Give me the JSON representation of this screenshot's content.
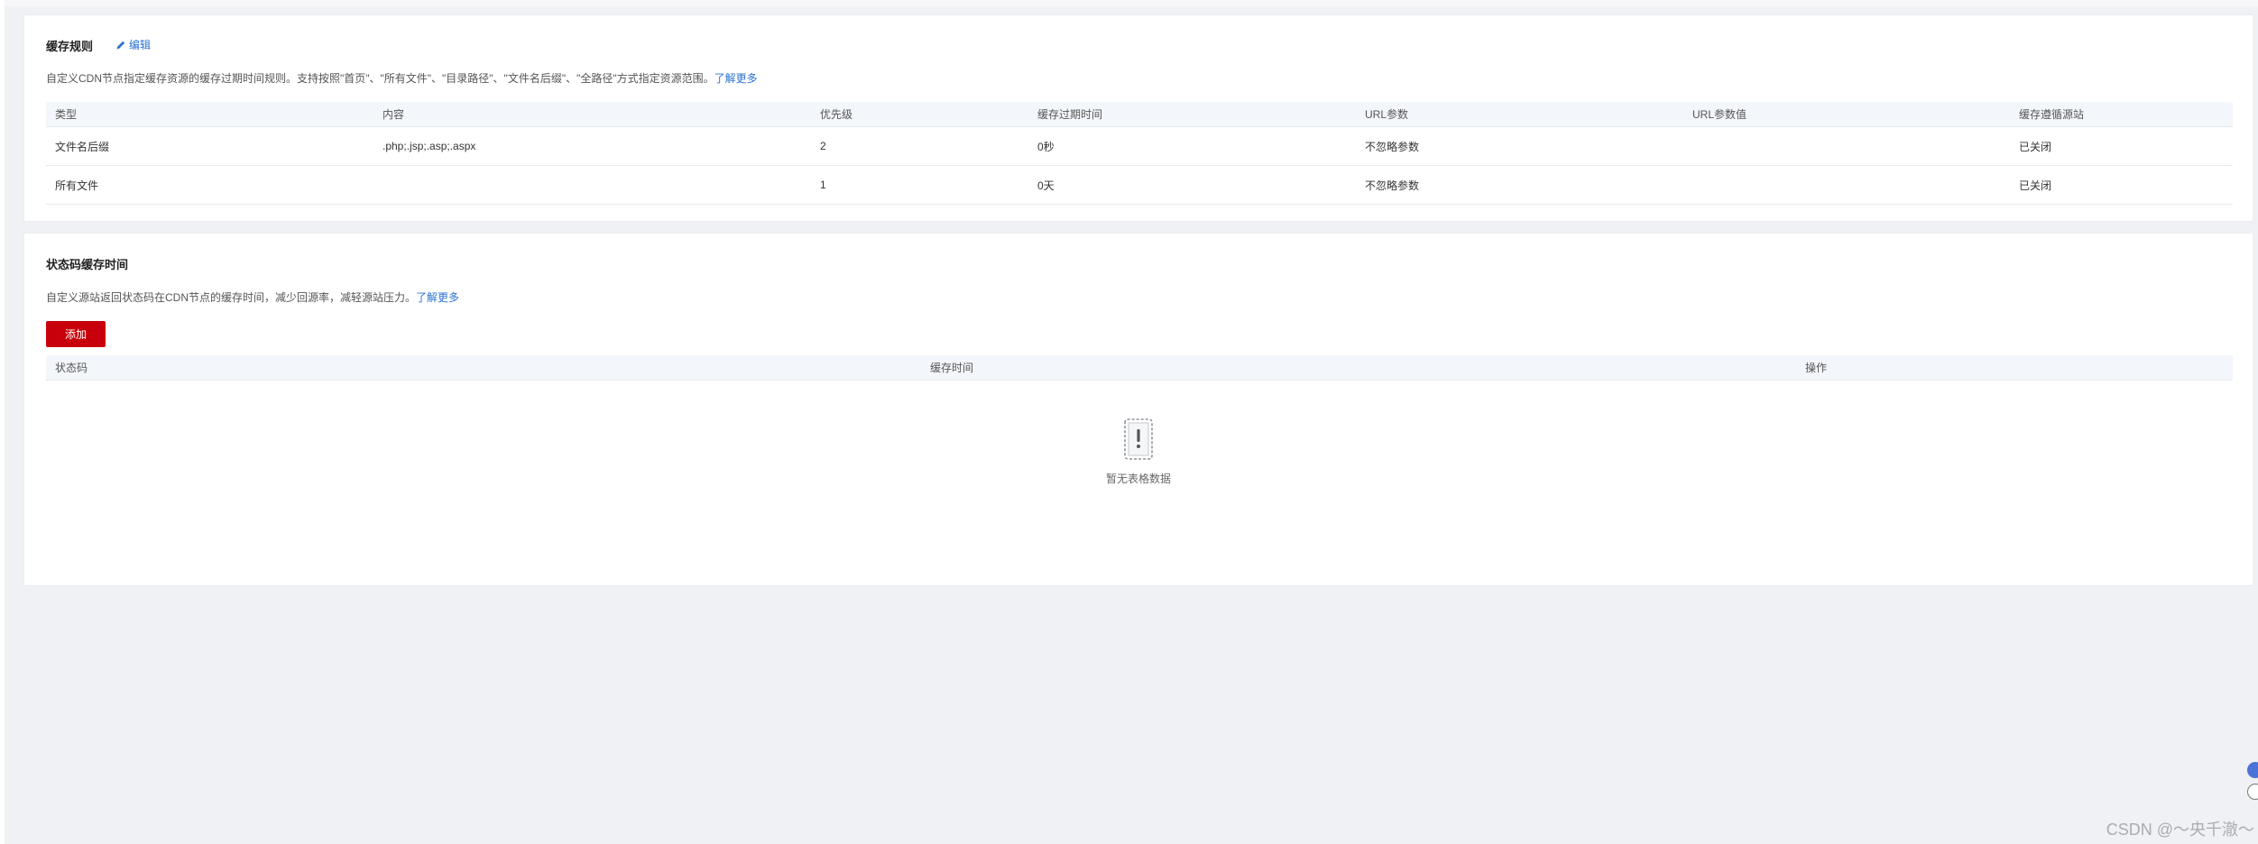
{
  "cache_rules": {
    "title": "缓存规则",
    "edit_label": "编辑",
    "description": "自定义CDN节点指定缓存资源的缓存过期时间规则。支持按照\"首页\"、\"所有文件\"、\"目录路径\"、\"文件名后缀\"、\"全路径\"方式指定资源范围。",
    "learn_more": "了解更多",
    "columns": [
      "类型",
      "内容",
      "优先级",
      "缓存过期时间",
      "URL参数",
      "URL参数值",
      "缓存遵循源站"
    ],
    "rows": [
      [
        "文件名后缀",
        ".php;.jsp;.asp;.aspx",
        "2",
        "0秒",
        "不忽略参数",
        "",
        "已关闭"
      ],
      [
        "所有文件",
        "",
        "1",
        "0天",
        "不忽略参数",
        "",
        "已关闭"
      ]
    ]
  },
  "status_code_cache": {
    "title": "状态码缓存时间",
    "description": "自定义源站返回状态码在CDN节点的缓存时间，减少回源率，减轻源站压力。",
    "learn_more": "了解更多",
    "add_button": "添加",
    "columns": [
      "状态码",
      "缓存时间",
      "操作"
    ],
    "empty_text": "暂无表格数据",
    "empty_icon": "empty-document-icon"
  },
  "watermark": "CSDN @～央千澈～",
  "colors": {
    "primary_button": "#c7000b",
    "link": "#2c73d2",
    "table_header_bg": "#f3f6fb",
    "page_bg": "#f0f1f4"
  }
}
